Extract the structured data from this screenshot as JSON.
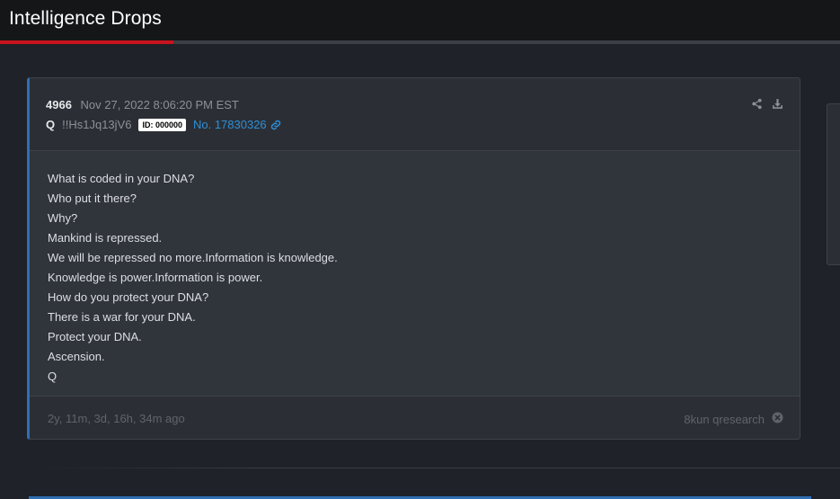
{
  "header": {
    "title": "Intelligence Drops"
  },
  "progress": {
    "fraction": 0.206
  },
  "drop": {
    "number": "4966",
    "date": "Nov 27, 2022 8:06:20 PM EST",
    "author": "Q",
    "tripcode": "!!Hs1Jq13jV6",
    "id_badge": "ID: 000000",
    "post_link": "No. 17830326",
    "lines": [
      "What is coded in your DNA?",
      "Who put it there?",
      "Why?",
      "Mankind is repressed.",
      "We will be repressed no more.Information is knowledge.",
      "Knowledge is power.Information is power.",
      "How do you protect your DNA?",
      "There is a war for your DNA.",
      "Protect your DNA.",
      "Ascension.",
      "Q"
    ],
    "elapsed": "2y, 11m, 3d, 16h, 34m ago",
    "source": "8kun qresearch"
  },
  "icons": {
    "share": "share-icon",
    "download": "download-icon",
    "link": "link-icon",
    "close": "close-circle-icon"
  },
  "colors": {
    "accent_red": "#c8141e",
    "link_blue": "#2e8fd6",
    "card_border_blue": "#2f6fb5"
  }
}
